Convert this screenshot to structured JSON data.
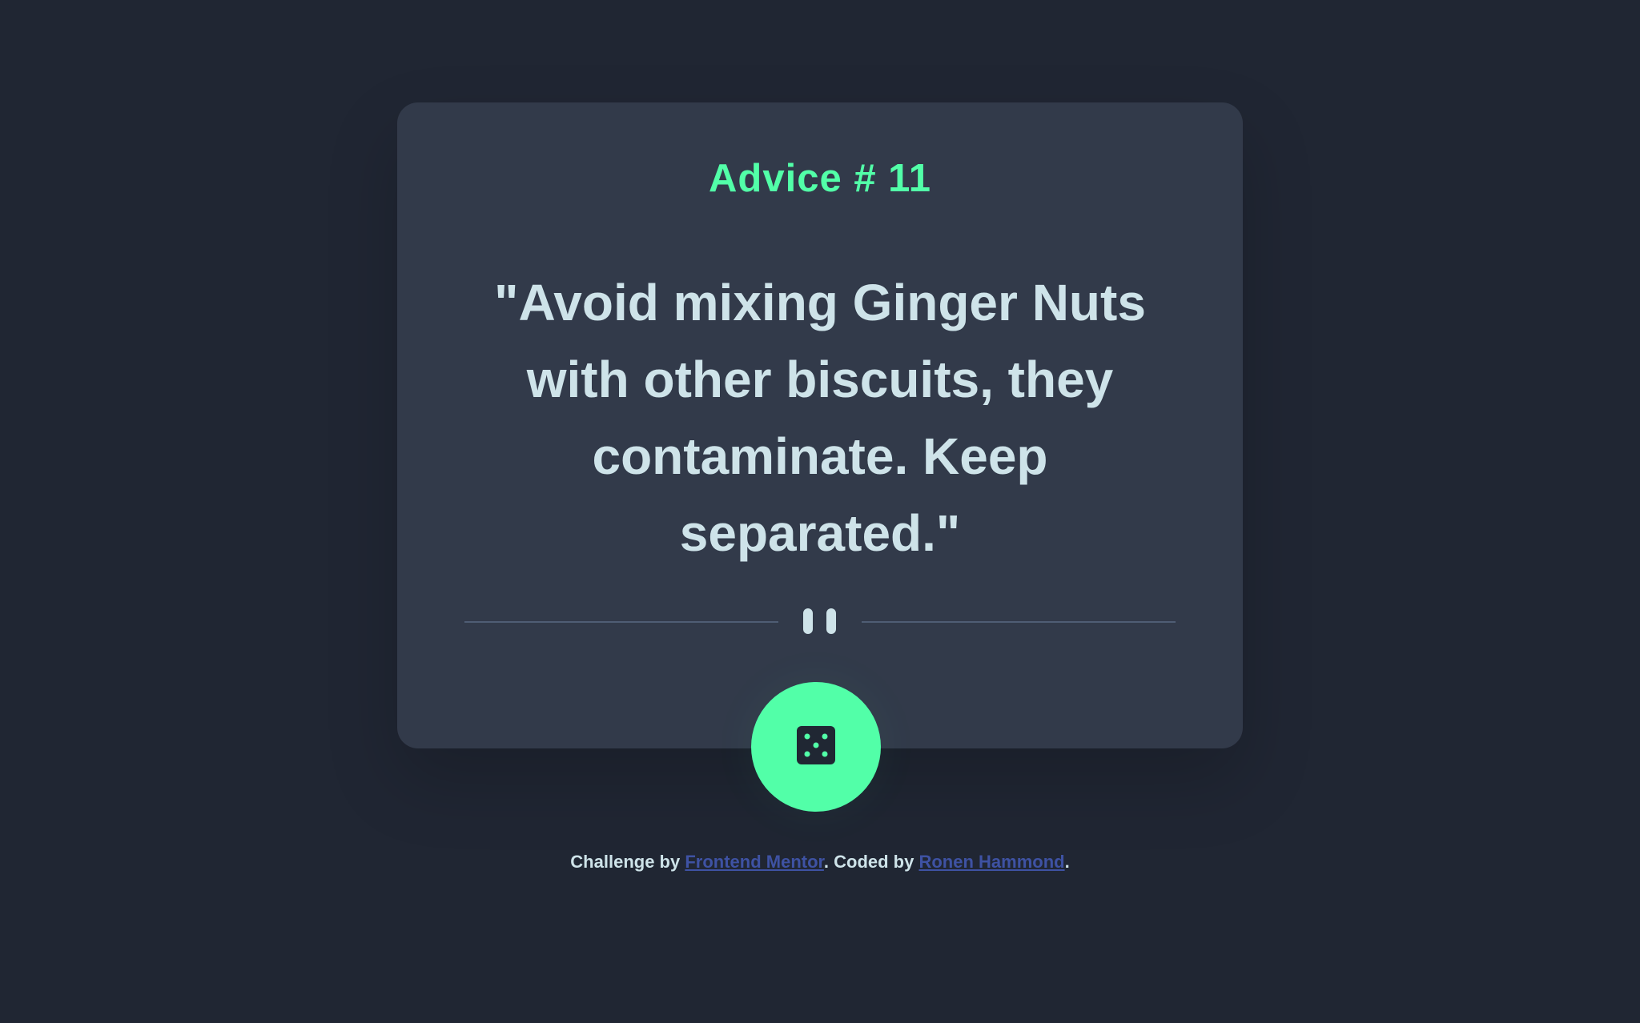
{
  "advice": {
    "heading": "Advice # 11",
    "quote": "\"Avoid mixing Ginger Nuts with other biscuits, they contaminate. Keep separated.\""
  },
  "divider": {
    "icon": "pause-icon"
  },
  "button": {
    "icon": "dice-icon"
  },
  "footer": {
    "challenge_by": "Challenge by ",
    "frontend_mentor": "Frontend Mentor",
    "coded_by": ". Coded by ",
    "author": "Ronen Hammond",
    "end": "."
  },
  "colors": {
    "background": "#202633",
    "card": "#323A4A",
    "accent": "#52FFA8",
    "text": "#CEE3E9",
    "divider": "#4F5D74",
    "link": "#3E52A3"
  }
}
